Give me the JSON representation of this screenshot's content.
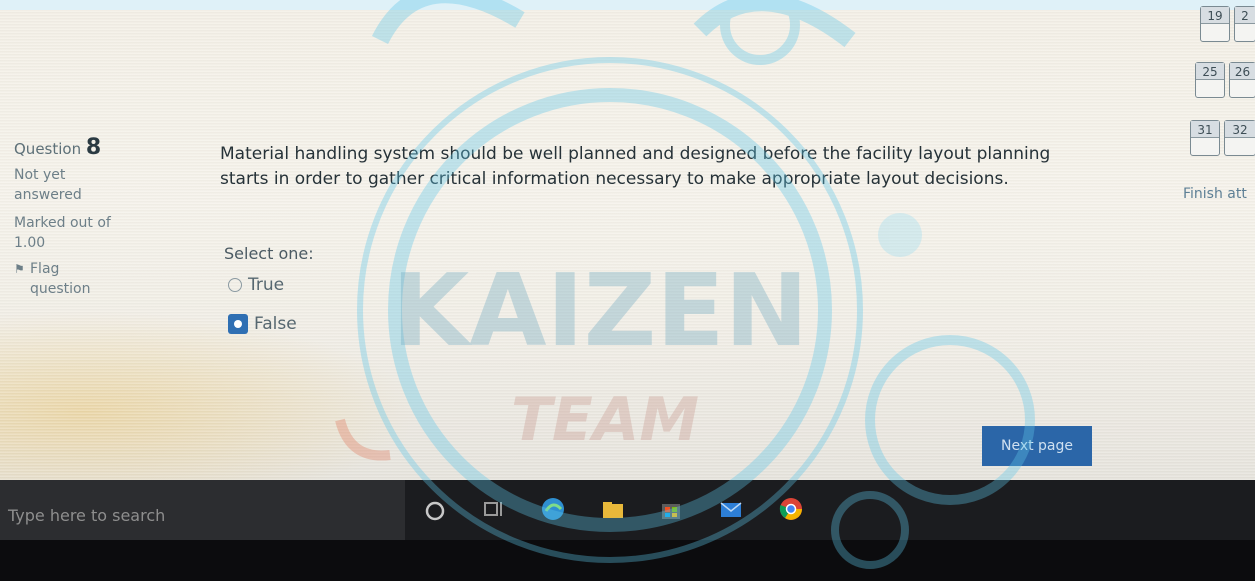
{
  "question": {
    "label": "Question",
    "number": "8",
    "status": "Not yet answered",
    "marks": "Marked out of 1.00",
    "flag_label": "Flag question",
    "text": "Material handling system should be well planned and designed before the facility layout planning starts in order to gather critical information necessary to make appropriate layout decisions.",
    "prompt": "Select one:",
    "options": [
      {
        "label": "True",
        "selected": false
      },
      {
        "label": "False",
        "selected": true
      }
    ]
  },
  "navigation": {
    "cells": [
      "19",
      "2",
      "25",
      "26",
      "31",
      "32"
    ],
    "finish_label": "Finish att"
  },
  "buttons": {
    "next_page": "Next page"
  },
  "taskbar": {
    "search_placeholder": "Type here to search",
    "icons": [
      "cortana-icon",
      "task-view-icon",
      "edge-icon",
      "file-explorer-icon",
      "store-icon",
      "mail-icon",
      "chrome-icon"
    ]
  },
  "watermark": {
    "title": "KAIZEN",
    "subtitle": "TEAM"
  },
  "colors": {
    "accent": "#2b66a8",
    "text": "#263238",
    "taskbar": "#1b1c1f"
  }
}
